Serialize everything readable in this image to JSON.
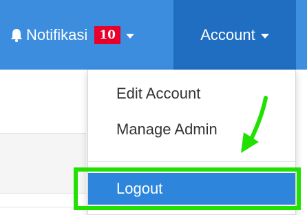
{
  "navbar": {
    "notifications": {
      "label": "Notifikasi",
      "count": "10",
      "icon": "bell-icon"
    },
    "account": {
      "label": "Account"
    },
    "colors": {
      "bar": "#3c8dde",
      "active": "#1f6ec1",
      "badge": "#e8002a"
    }
  },
  "account_menu": {
    "items": [
      {
        "label": "Edit Account"
      },
      {
        "label": "Manage Admin"
      }
    ],
    "logout": {
      "label": "Logout"
    },
    "colors": {
      "logout_bg": "#2e86dc",
      "annotation": "#22e000"
    }
  }
}
